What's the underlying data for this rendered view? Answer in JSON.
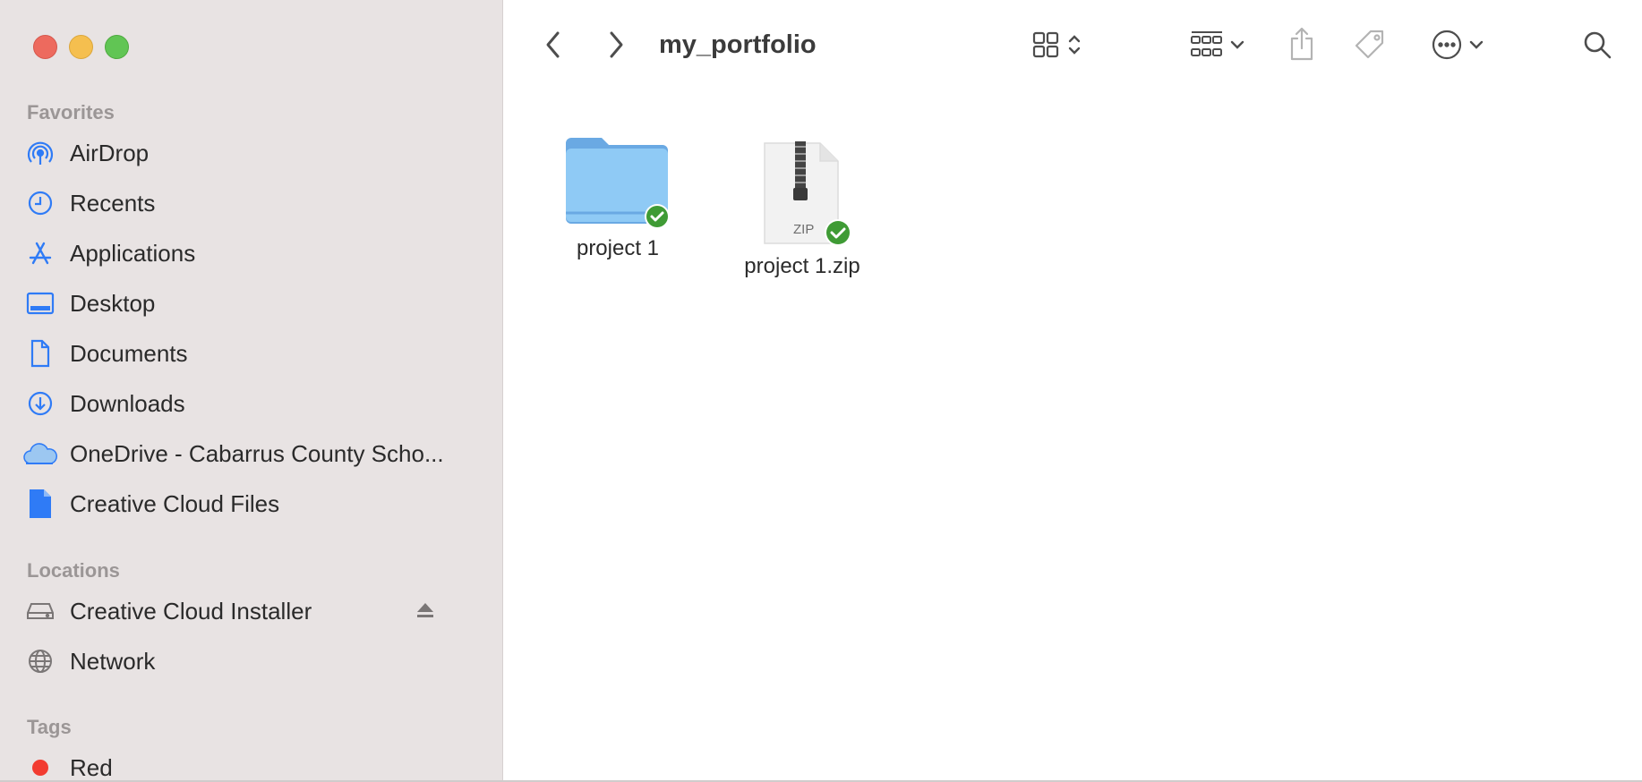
{
  "window": {
    "title": "my_portfolio"
  },
  "sidebar": {
    "sections": [
      {
        "label": "Favorites"
      },
      {
        "label": "Locations"
      },
      {
        "label": "Tags"
      }
    ],
    "favorites": [
      {
        "label": "AirDrop",
        "icon": "airdrop-icon"
      },
      {
        "label": "Recents",
        "icon": "clock-icon"
      },
      {
        "label": "Applications",
        "icon": "applications-icon"
      },
      {
        "label": "Desktop",
        "icon": "desktop-icon"
      },
      {
        "label": "Documents",
        "icon": "document-icon"
      },
      {
        "label": "Downloads",
        "icon": "download-icon"
      },
      {
        "label": "OneDrive - Cabarrus County Scho...",
        "icon": "cloud-icon"
      },
      {
        "label": "Creative Cloud Files",
        "icon": "file-icon"
      }
    ],
    "locations": [
      {
        "label": "Creative Cloud Installer",
        "icon": "drive-icon"
      },
      {
        "label": "Network",
        "icon": "globe-icon"
      }
    ],
    "tags": [
      {
        "label": "Red",
        "color": "#f23b30"
      }
    ]
  },
  "files": [
    {
      "label": "project 1",
      "type": "folder",
      "status": "synced"
    },
    {
      "label": "project 1.zip",
      "type": "zip",
      "badge": "ZIP",
      "status": "synced"
    }
  ],
  "colors": {
    "accent": "#2f7bf6",
    "sync_check": "#3f9b35",
    "folder": "#8fcaf5"
  }
}
